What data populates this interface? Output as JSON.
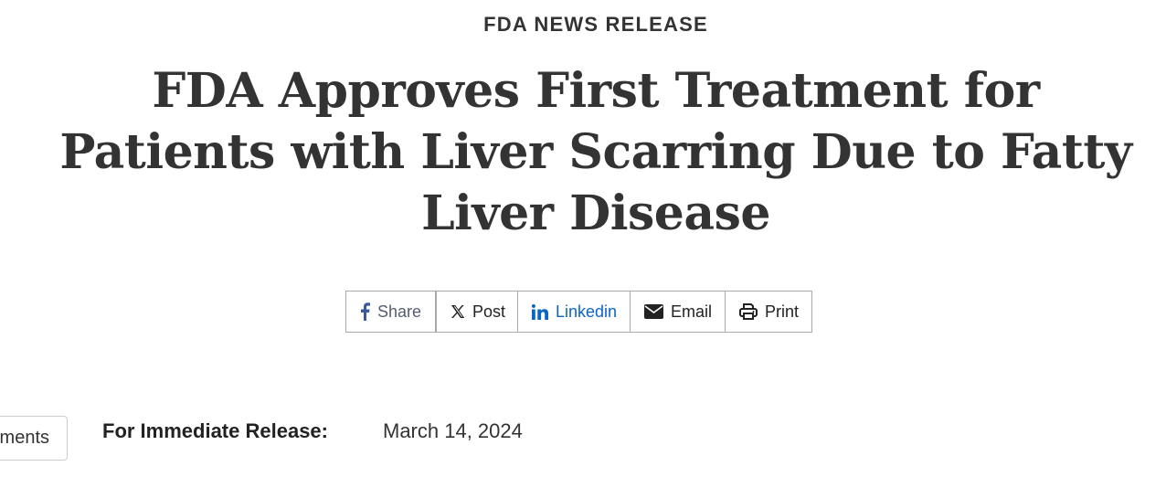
{
  "header": {
    "eyebrow": "FDA NEWS RELEASE",
    "title": "FDA Approves First Treatment for Patients with Liver Scarring Due to Fatty Liver Disease"
  },
  "share": {
    "buttons": [
      {
        "label": "Share",
        "icon": "facebook-icon",
        "color": "#3b5998"
      },
      {
        "label": "Post",
        "icon": "x-icon",
        "color": "#222222"
      },
      {
        "label": "Linkedin",
        "icon": "linkedin-icon",
        "color": "#0a66c2"
      },
      {
        "label": "Email",
        "icon": "envelope-icon",
        "color": "#222222"
      },
      {
        "label": "Print",
        "icon": "printer-icon",
        "color": "#222222"
      }
    ]
  },
  "sidebar": {
    "tab_label": "ments"
  },
  "release": {
    "label": "For Immediate Release:",
    "date": "March 14, 2024"
  }
}
